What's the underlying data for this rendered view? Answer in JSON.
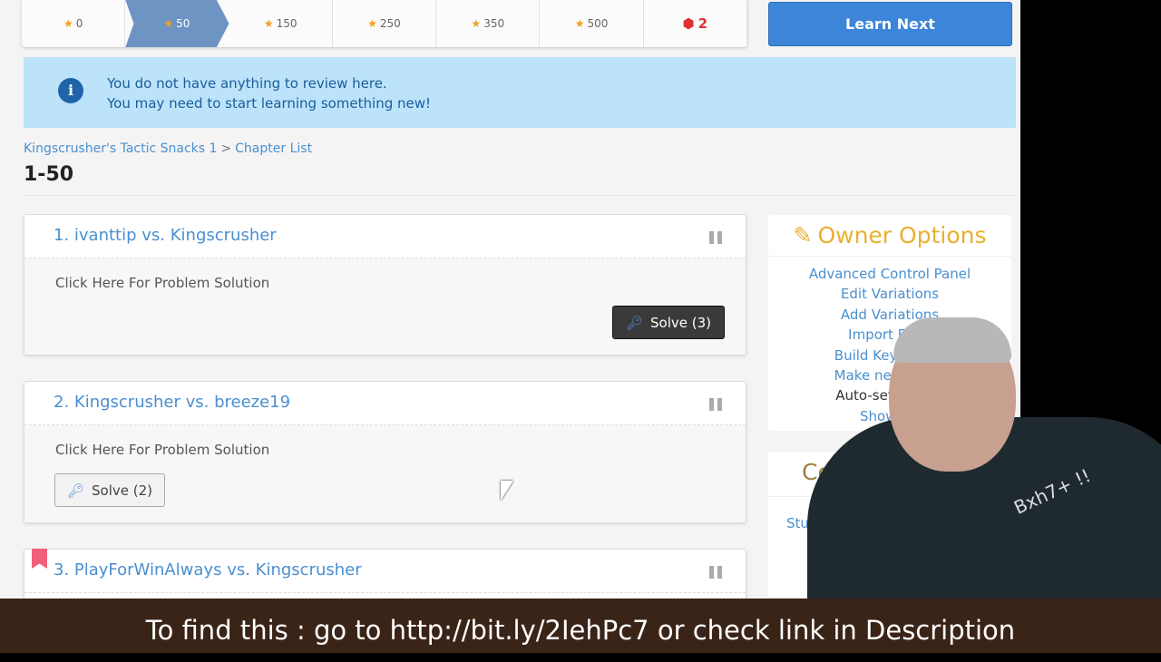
{
  "progress": {
    "steps": [
      "0",
      "50",
      "150",
      "250",
      "350",
      "500"
    ],
    "active_index": 1,
    "errors": "2"
  },
  "learn_next": "Learn Next",
  "alert": {
    "line1": "You do not have anything to review here.",
    "line2": "You may need to start learning something new!"
  },
  "breadcrumb": {
    "course": "Kingscrusher's Tactic Snacks 1",
    "sep": ">",
    "chapter_list": "Chapter List"
  },
  "title": "1-50",
  "problems": [
    {
      "title": "1. ivanttip vs. Kingscrusher",
      "body": "Click Here For Problem Solution",
      "solve": "Solve (3)"
    },
    {
      "title": "2. Kingscrusher vs. breeze19",
      "body": "Click Here For Problem Solution",
      "solve": "Solve (2)"
    },
    {
      "title": "3. PlayForWinAlways vs. Kingscrusher"
    }
  ],
  "owner": {
    "title": "Owner Options",
    "items": [
      "Advanced Control Panel",
      "Edit Variations",
      "Add Variations",
      "Import From",
      "Build Key Moves",
      "Make new text c",
      "Auto-set color b",
      "Show De"
    ]
  },
  "course": {
    "title": "Cour",
    "link": "Stu"
  },
  "webcam": {
    "shirt_text": "Bxh7+ !!"
  },
  "caption": "To find this : go to  http://bit.ly/2IehPc7 or check link in Description"
}
